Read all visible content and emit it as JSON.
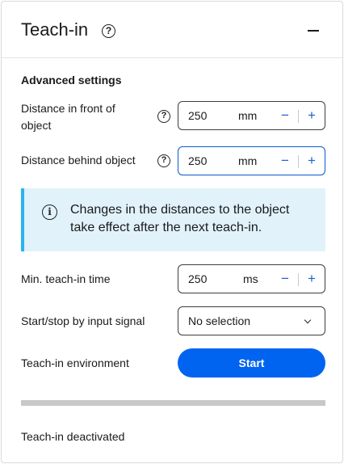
{
  "panel": {
    "title": "Teach-in",
    "help_icon": "question-circle-icon",
    "collapse_icon": "minus-icon"
  },
  "advanced": {
    "section_title": "Advanced settings",
    "distance_front": {
      "label": "Distance in front of object",
      "value": "250",
      "unit": "mm",
      "minus": "−",
      "plus": "+"
    },
    "distance_behind": {
      "label": "Distance behind object",
      "value": "250",
      "unit": "mm",
      "minus": "−",
      "plus": "+"
    },
    "info": {
      "icon": "info-circle-icon",
      "text": "Changes in the distances to the object take effect after the next teach-in."
    },
    "min_time": {
      "label": "Min. teach-in time",
      "value": "250",
      "unit": "ms",
      "minus": "−",
      "plus": "+"
    },
    "input_signal": {
      "label": "Start/stop by input signal",
      "selected": "No selection"
    },
    "environment": {
      "label": "Teach-in environment",
      "button": "Start"
    },
    "progress": 0,
    "status": "Teach-in deactivated"
  },
  "colors": {
    "accent": "#0064f0",
    "info_bg": "#e1f2fb",
    "info_border": "#2bb3ea",
    "progress_track": "#c8c8c8"
  }
}
